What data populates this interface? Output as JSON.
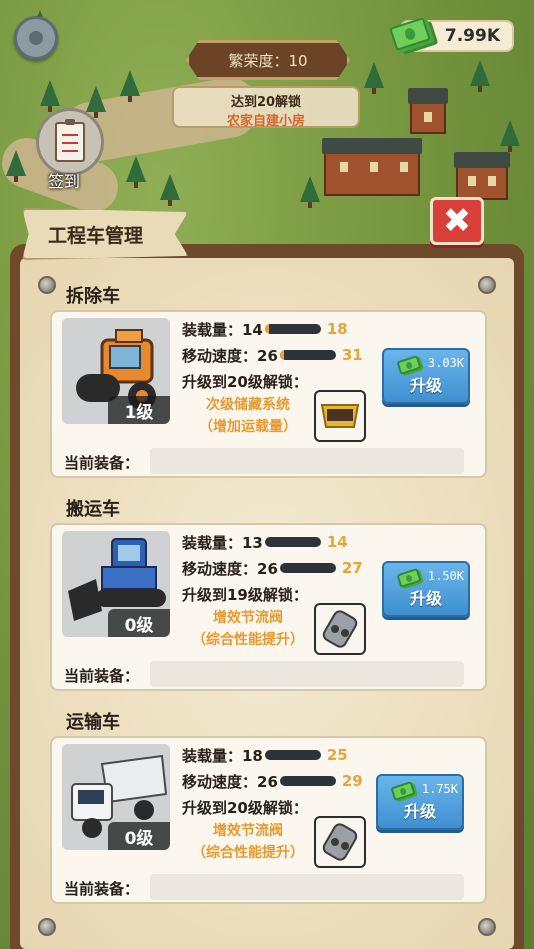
{
  "hud": {
    "money": "7.99K",
    "prosperity": "繁荣度：10",
    "unlock_line1": "达到20解锁",
    "unlock_line2": "农家自建小房",
    "signin_label": "签到"
  },
  "panel": {
    "title": "工程车管理",
    "close_symbol": "✖"
  },
  "vehicles": [
    {
      "section": "拆除车",
      "level": "1级",
      "capacity_label": "装载量：14",
      "capacity_next": "18",
      "capacity_progress": 0.08,
      "speed_label": "移动速度：26",
      "speed_next": "31",
      "speed_progress": 0.08,
      "unlock_label": "升级到20级解锁：",
      "unlock_item_line1": "次级储藏系统",
      "unlock_item_line2": "（增加运载量）",
      "upgrade_cost": "3.03K",
      "upgrade_label": "升级",
      "equip_label": "当前装备：",
      "equip_value": ""
    },
    {
      "section": "搬运车",
      "level": "0级",
      "capacity_label": "装载量：13",
      "capacity_next": "14",
      "capacity_progress": 0,
      "speed_label": "移动速度：26",
      "speed_next": "27",
      "speed_progress": 0,
      "unlock_label": "升级到19级解锁：",
      "unlock_item_line1": "增效节流阀",
      "unlock_item_line2": "（综合性能提升）",
      "upgrade_cost": "1.50K",
      "upgrade_label": "升级",
      "equip_label": "当前装备：",
      "equip_value": ""
    },
    {
      "section": "运输车",
      "level": "0级",
      "capacity_label": "装载量：18",
      "capacity_next": "25",
      "capacity_progress": 0,
      "speed_label": "移动速度：26",
      "speed_next": "29",
      "speed_progress": 0,
      "unlock_label": "升级到20级解锁：",
      "unlock_item_line1": "增效节流阀",
      "unlock_item_line2": "（综合性能提升）",
      "upgrade_cost": "1.75K",
      "upgrade_label": "升级",
      "equip_label": "当前装备：",
      "equip_value": ""
    }
  ],
  "colors": {
    "accent_orange": "#e69a2e",
    "upgrade_blue": "#3f8fd0",
    "close_red": "#d9403a"
  }
}
